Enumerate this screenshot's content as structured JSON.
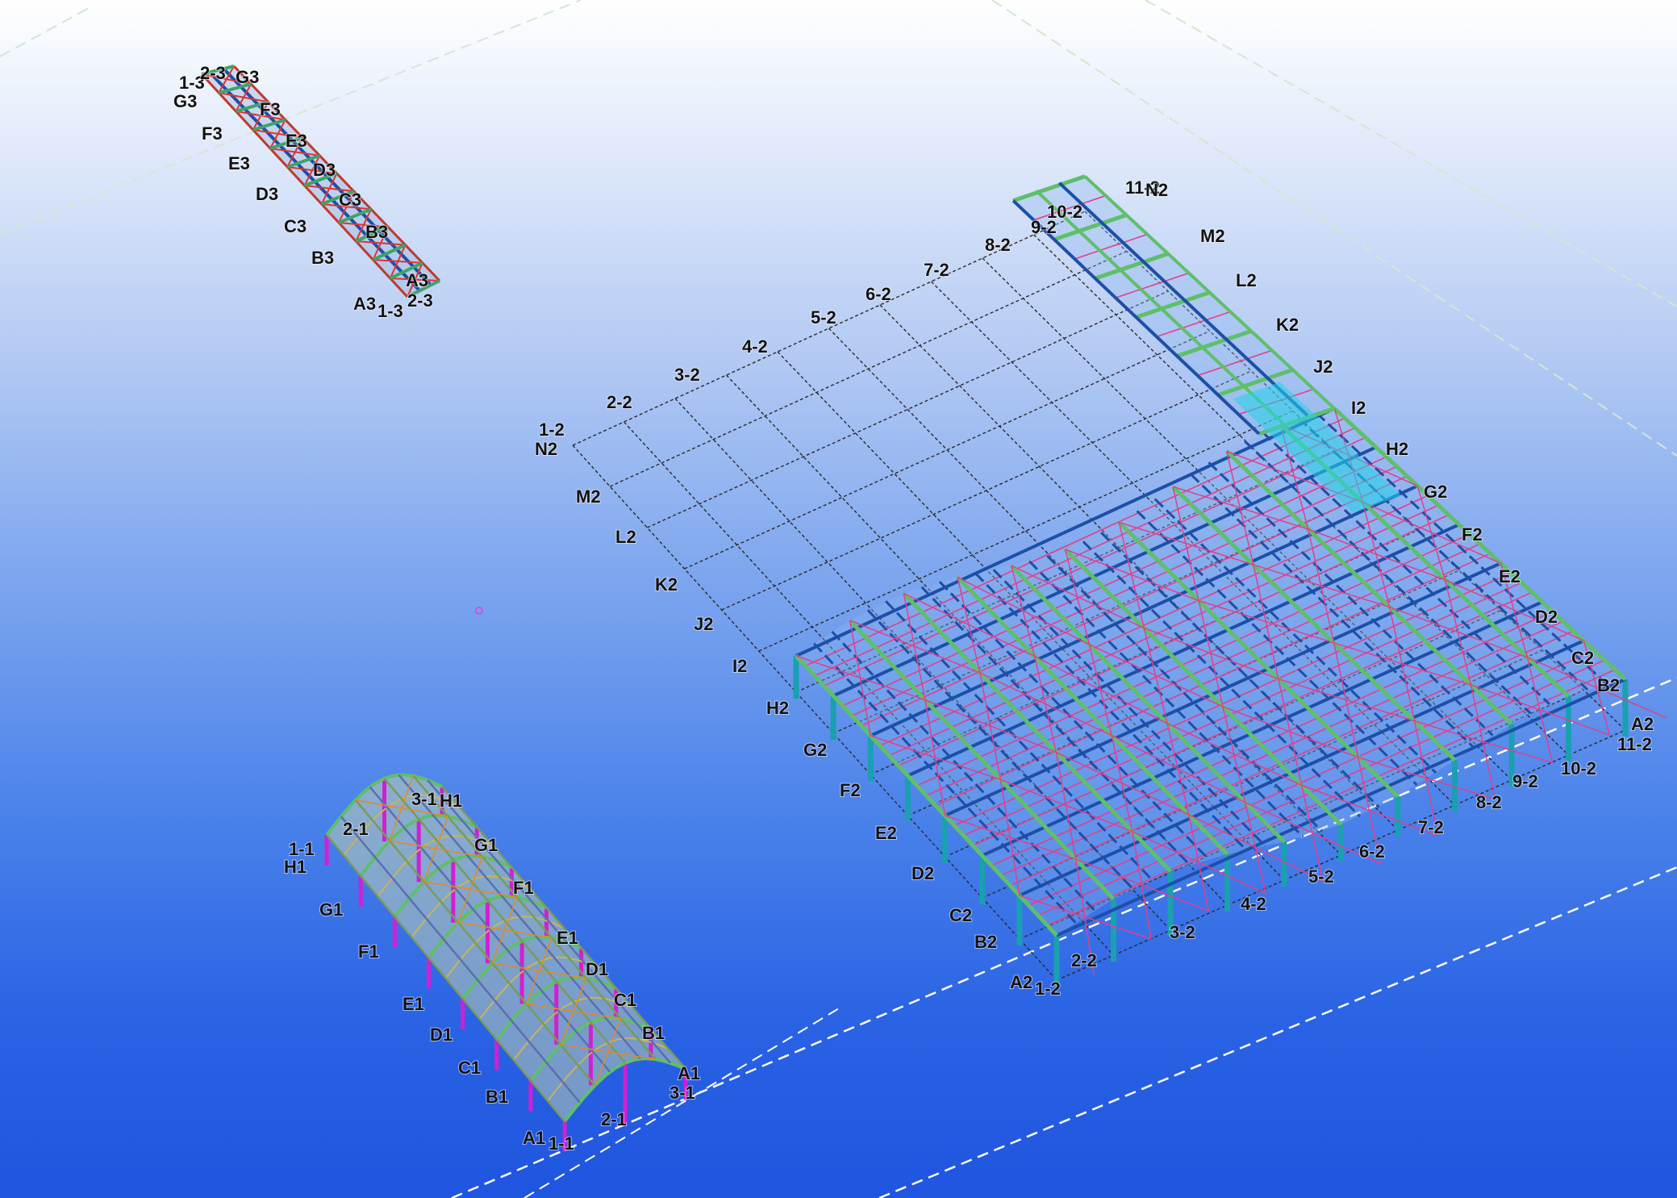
{
  "structures": {
    "top_left": {
      "name": "structure-3",
      "row_labels": [
        "G3",
        "F3",
        "E3",
        "D3",
        "C3",
        "B3",
        "A3"
      ],
      "right_labels": [
        "F3",
        "E3",
        "D3",
        "C3",
        "B3",
        "A3"
      ],
      "end_labels_top": [
        "1-3",
        "2-3",
        "G3"
      ],
      "end_labels_bottom": [
        "1-3",
        "2-3"
      ]
    },
    "main": {
      "name": "structure-2",
      "col_labels": [
        "1-2",
        "2-2",
        "3-2",
        "4-2",
        "5-2",
        "6-2",
        "7-2",
        "8-2",
        "9-2",
        "10-2",
        "11-2"
      ],
      "col_labels_bottom": [
        "1-2",
        "2-2",
        "3-2",
        "4-2",
        "5-2",
        "6-2",
        "7-2",
        "8-2",
        "9-2",
        "10-2",
        "11-2"
      ],
      "row_labels_left": [
        "N2",
        "M2",
        "L2",
        "K2",
        "J2",
        "I2",
        "H2",
        "G2",
        "F2",
        "E2",
        "D2",
        "C2",
        "B2",
        "A2"
      ],
      "row_labels_right": [
        "N2",
        "M2",
        "L2",
        "K2",
        "J2",
        "I2",
        "H2",
        "G2",
        "F2",
        "E2",
        "D2",
        "C2",
        "B2",
        "A2"
      ]
    },
    "bottom_left": {
      "name": "structure-1",
      "row_labels_left": [
        "H1",
        "G1",
        "F1",
        "E1",
        "D1",
        "C1",
        "B1",
        "A1"
      ],
      "row_labels_right": [
        "H1",
        "G1",
        "F1",
        "E1",
        "D1",
        "C1",
        "B1",
        "A1"
      ],
      "col_labels_top": [
        "1-1",
        "2-1",
        "3-1"
      ],
      "col_labels_bottom": [
        "1-1",
        "2-1",
        "3-1"
      ]
    }
  },
  "colors": {
    "beam_blue": "#1d4fa8",
    "beam_green": "#5fbf6a",
    "brace_pink": "#e0408c",
    "column_teal": "#1aa0b0",
    "column_magenta": "#d21fd2",
    "highlight_cyan": "#22d4e8",
    "grid_line": "#333333"
  },
  "icons": [
    "cursor-icon"
  ]
}
